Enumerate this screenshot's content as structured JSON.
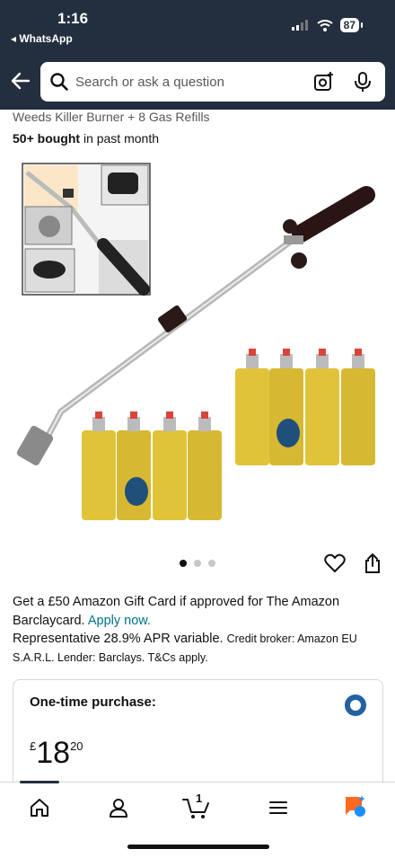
{
  "status_bar": {
    "time": "1:16",
    "back_app": "◂ WhatsApp",
    "battery": "87"
  },
  "search": {
    "placeholder": "Search or ask a question"
  },
  "product": {
    "title_partial": "Weeds Killer Burner + 8 Gas Refills",
    "bought_count": "50+ bought",
    "bought_suffix": " in past month"
  },
  "gallery": {
    "total_images": 3,
    "active_index": 0
  },
  "promo": {
    "line1": "Get a £50 Amazon Gift Card if approved for The Amazon Barclaycard.",
    "apply_link": "Apply now.",
    "apr": "Representative 28.9% APR variable.",
    "credit": "Credit broker: Amazon EU S.A.R.L. Lender: Barclays. T&Cs apply."
  },
  "purchase": {
    "option_label": "One-time purchase:",
    "currency": "£",
    "price_whole": "18",
    "price_fraction": "20"
  },
  "bottom_nav": {
    "cart_count": "1",
    "items": [
      "home-icon",
      "account-icon",
      "cart-icon",
      "menu-icon",
      "rufus-icon"
    ]
  },
  "colors": {
    "header": "#232f3e",
    "link": "#007185",
    "radio": "#2162a1",
    "rufus_orange": "#ff6a21",
    "rufus_blue": "#1b8eff"
  }
}
